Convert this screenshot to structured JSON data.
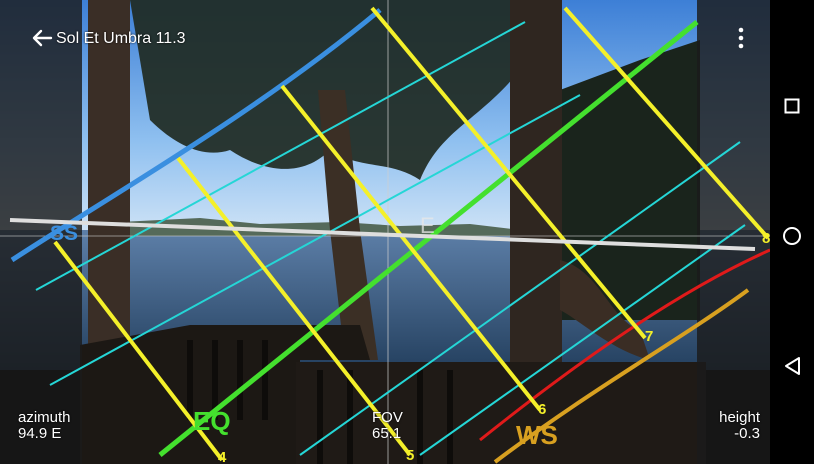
{
  "app": {
    "title": "Sol Et Umbra 11.3"
  },
  "readouts": {
    "azimuth_label": "azimuth",
    "azimuth_value": "94.9 E",
    "fov_label": "FOV",
    "fov_value": "65.1",
    "height_label": "height",
    "height_value": "-0.3"
  },
  "overlay": {
    "horizon_marker": "E",
    "sun_path_labels": [
      "SS",
      "EQ",
      "WS"
    ],
    "hour_labels": [
      "4",
      "5",
      "6",
      "7",
      "8"
    ]
  },
  "colors": {
    "summer_solstice": "#3a8fe0",
    "equinox": "#44e02e",
    "winter_solstice": "#d8a020",
    "hour_lines": "#f4f02a",
    "cyan_paths": "#25d6d6",
    "sunset_curve": "#e01a1a",
    "horizon": "#dedede"
  },
  "icons": {
    "back": "arrow-left-icon",
    "menu": "more-vert-icon",
    "recents": "square-icon",
    "home": "circle-icon",
    "nav_back": "triangle-left-icon"
  }
}
